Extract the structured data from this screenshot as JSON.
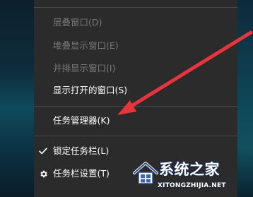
{
  "context_menu": {
    "items": [
      {
        "label": "层叠窗口(D)",
        "enabled": false
      },
      {
        "label": "堆叠显示窗口(E)",
        "enabled": false
      },
      {
        "label": "并排显示窗口(I)",
        "enabled": false
      },
      {
        "label": "显示打开的窗口(S)",
        "enabled": true
      },
      {
        "label": "任务管理器(K)",
        "enabled": true
      },
      {
        "label": "锁定任务栏(L)",
        "enabled": true,
        "checked": true,
        "icon": "checkmark-icon"
      },
      {
        "label": "任务栏设置(T)",
        "enabled": true,
        "icon": "gear-icon"
      }
    ]
  },
  "watermark": {
    "title": "系统之家",
    "url": "XITONGZHIJIA.NET"
  },
  "colors": {
    "menu_bg": "#2b2b2b",
    "separator": "#4b4b4b",
    "text": "#ffffff",
    "disabled_text": "#7a7a7a",
    "annotation_arrow": "#e8353d",
    "desktop_teal": "#0f4a5c"
  }
}
